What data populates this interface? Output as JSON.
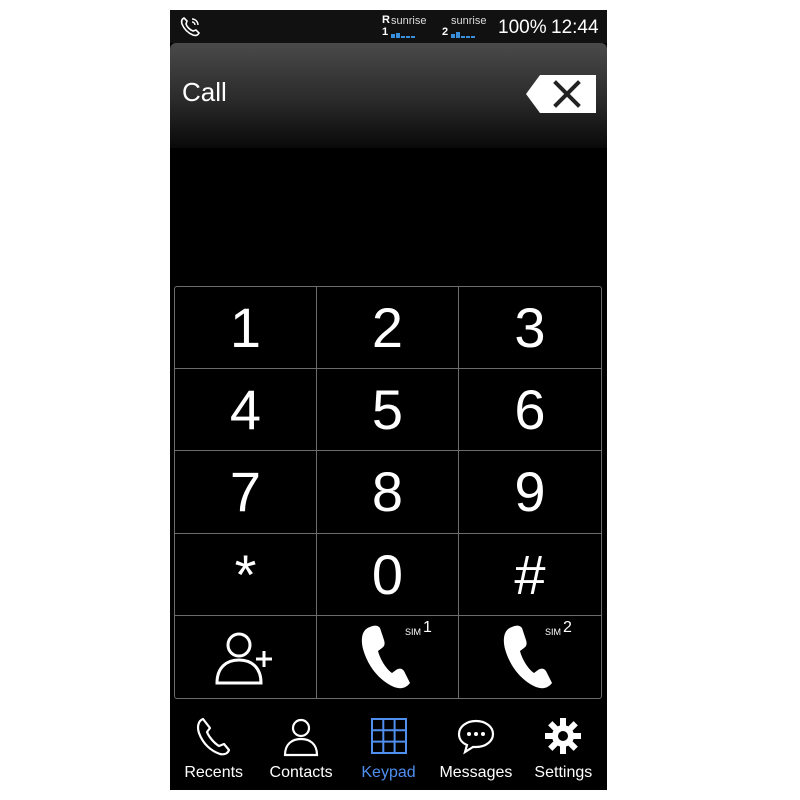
{
  "status_bar": {
    "sim1": {
      "roaming": "R",
      "index": "1",
      "carrier": "sunrise"
    },
    "sim2": {
      "index": "2",
      "carrier": "sunrise"
    },
    "battery": "100%",
    "time": "12:44",
    "signal_color": "#3a8fdc"
  },
  "header": {
    "title": "Call",
    "backspace_icon": "backspace-icon"
  },
  "keypad": {
    "keys": [
      "1",
      "2",
      "3",
      "4",
      "5",
      "6",
      "7",
      "8",
      "9",
      "*",
      "0",
      "#"
    ],
    "add_contact_icon": "add-contact-icon",
    "sim1_call": {
      "label": "SIM",
      "num": "1"
    },
    "sim2_call": {
      "label": "SIM",
      "num": "2"
    }
  },
  "nav": {
    "items": [
      {
        "label": "Recents",
        "icon": "phone-icon"
      },
      {
        "label": "Contacts",
        "icon": "person-icon"
      },
      {
        "label": "Keypad",
        "icon": "grid-icon"
      },
      {
        "label": "Messages",
        "icon": "chat-icon"
      },
      {
        "label": "Settings",
        "icon": "gear-icon"
      }
    ],
    "active": "Keypad",
    "active_color": "#4f8ff0"
  }
}
